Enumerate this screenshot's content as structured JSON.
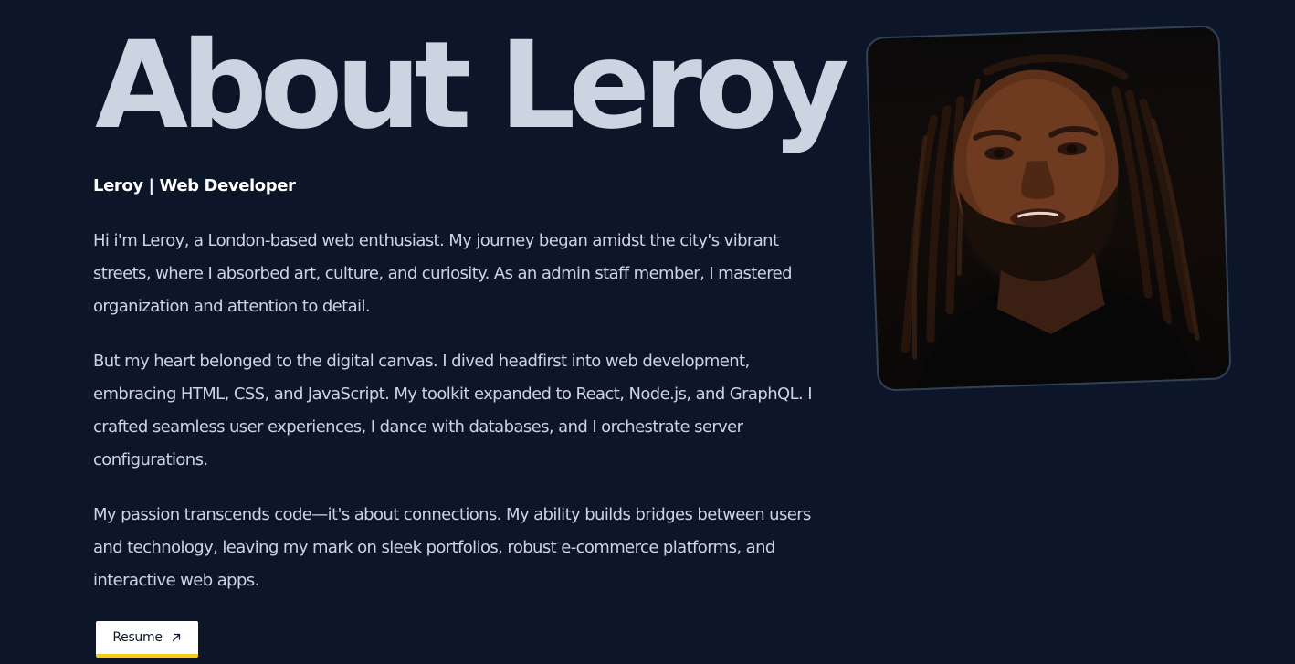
{
  "about": {
    "title": "About Leroy",
    "subtitle": "Leroy | Web Developer",
    "paragraphs": [
      "Hi i'm Leroy, a London-based web enthusiast. My journey began amidst the city's vibrant streets, where I absorbed art, culture, and curiosity. As an admin staff member, I mastered organization and attention to detail.",
      "But my heart belonged to the digital canvas. I dived headfirst into web development, embracing HTML, CSS, and JavaScript. My toolkit expanded to React, Node.js, and GraphQL. I crafted seamless user experiences, I dance with databases, and I orchestrate server configurations.",
      "My passion transcends code—it's about connections. My ability builds bridges between users and technology, leaving my mark on sleek portfolios, robust e-commerce platforms, and interactive web apps."
    ],
    "resume_label": "Resume",
    "resume_icon": "arrow-up-right-icon",
    "photo_icon": "profile-photo"
  },
  "colors": {
    "background": "#0d1528",
    "text": "#cbd5e1",
    "heading": "#cbd5e1",
    "button_bg": "#ffffff",
    "button_accent": "#facc15",
    "card_border": "#334155"
  }
}
